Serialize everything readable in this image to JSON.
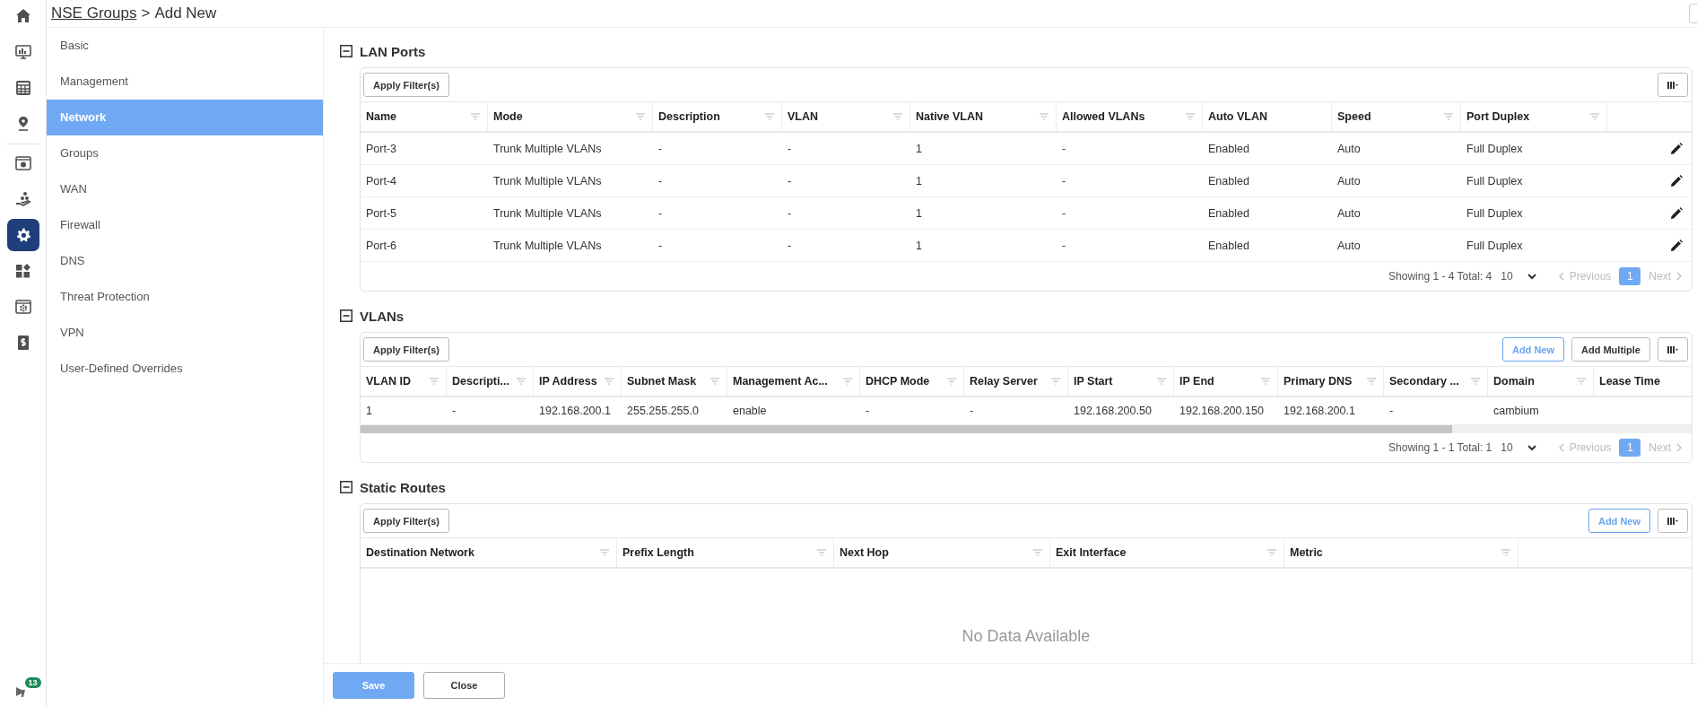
{
  "breadcrumb": {
    "link": "NSE Groups",
    "separator": ">",
    "current": "Add New"
  },
  "rail": {
    "items": [
      {
        "selected": false
      },
      {
        "selected": false
      },
      {
        "selected": false
      },
      {
        "selected": false
      },
      {
        "selected": false
      },
      {
        "selected": false
      },
      {
        "selected": true
      },
      {
        "selected": false
      },
      {
        "selected": false
      },
      {
        "selected": false
      }
    ],
    "notifications": {
      "badge": "13"
    }
  },
  "nav": {
    "items": [
      {
        "label": "Basic",
        "selected": false
      },
      {
        "label": "Management",
        "selected": false
      },
      {
        "label": "Network",
        "selected": true
      },
      {
        "label": "Groups",
        "selected": false
      },
      {
        "label": "WAN",
        "selected": false
      },
      {
        "label": "Firewall",
        "selected": false
      },
      {
        "label": "DNS",
        "selected": false
      },
      {
        "label": "Threat Protection",
        "selected": false
      },
      {
        "label": "VPN",
        "selected": false
      },
      {
        "label": "User-Defined Overrides",
        "selected": false
      }
    ]
  },
  "sections": [
    {
      "title": "LAN Ports",
      "expanded": true,
      "filter_button": "Apply Filter(s)",
      "table": {
        "columns": [
          {
            "label": "Name",
            "filter": true
          },
          {
            "label": "Mode",
            "filter": true
          },
          {
            "label": "Description",
            "filter": true
          },
          {
            "label": "VLAN",
            "filter": true
          },
          {
            "label": "Native VLAN",
            "filter": true
          },
          {
            "label": "Allowed VLANs",
            "filter": true
          },
          {
            "label": "Auto VLAN",
            "filter": false
          },
          {
            "label": "Speed",
            "filter": true
          },
          {
            "label": "Port Duplex",
            "filter": true
          },
          {}
        ],
        "rows": [
          {
            "cells": [
              "Port-3",
              "Trunk Multiple VLANs",
              "-",
              "-",
              "1",
              "-",
              "Enabled",
              "Auto",
              "Full Duplex"
            ],
            "editable": true
          },
          {
            "cells": [
              "Port-4",
              "Trunk Multiple VLANs",
              "-",
              "-",
              "1",
              "-",
              "Enabled",
              "Auto",
              "Full Duplex"
            ],
            "editable": true
          },
          {
            "cells": [
              "Port-5",
              "Trunk Multiple VLANs",
              "-",
              "-",
              "1",
              "-",
              "Enabled",
              "Auto",
              "Full Duplex"
            ],
            "editable": true
          },
          {
            "cells": [
              "Port-6",
              "Trunk Multiple VLANs",
              "-",
              "-",
              "1",
              "-",
              "Enabled",
              "Auto",
              "Full Duplex"
            ],
            "editable": true
          }
        ]
      },
      "pagination": {
        "summary": "Showing 1 - 4 Total: 4",
        "page_size": "10",
        "previous": {
          "label": "Previous",
          "disabled": true
        },
        "pages": [
          {
            "label": "1",
            "selected": true
          }
        ],
        "next": {
          "label": "Next",
          "disabled": true
        }
      }
    },
    {
      "title": "VLANs",
      "expanded": true,
      "filter_button": "Apply Filter(s)",
      "buttons": [
        {
          "label": "Add New",
          "kind": "outline"
        },
        {
          "label": "Add Multiple",
          "kind": "default"
        }
      ],
      "table": {
        "horizontal_scroll": true,
        "columns": [
          {
            "label": "VLAN ID",
            "filter": true
          },
          {
            "label": "Descripti...",
            "filter": true
          },
          {
            "label": "IP Address",
            "filter": true
          },
          {
            "label": "Subnet Mask",
            "filter": true
          },
          {
            "label": "Management Ac...",
            "filter": true
          },
          {
            "label": "DHCP Mode",
            "filter": true
          },
          {
            "label": "Relay Server",
            "filter": true
          },
          {
            "label": "IP Start",
            "filter": true
          },
          {
            "label": "IP End",
            "filter": true
          },
          {
            "label": "Primary DNS",
            "filter": true
          },
          {
            "label": "Secondary ...",
            "filter": true
          },
          {
            "label": "Domain",
            "filter": true
          },
          {
            "label": "Lease Time",
            "filter": false
          }
        ],
        "rows": [
          {
            "cells": [
              "1",
              "-",
              "192.168.200.1",
              "255.255.255.0",
              "enable",
              "-",
              "-",
              "192.168.200.50",
              "192.168.200.150",
              "192.168.200.1",
              "-",
              "cambium"
            ]
          }
        ]
      },
      "pagination": {
        "summary": "Showing 1 - 1 Total: 1",
        "page_size": "10",
        "previous": {
          "label": "Previous",
          "disabled": true
        },
        "pages": [
          {
            "label": "1",
            "selected": true
          }
        ],
        "next": {
          "label": "Next",
          "disabled": true
        }
      }
    },
    {
      "title": "Static Routes",
      "expanded": true,
      "filter_button": "Apply Filter(s)",
      "buttons": [
        {
          "label": "Add New",
          "kind": "outline"
        }
      ],
      "table": {
        "columns": [
          {
            "label": "Destination Network",
            "filter": true
          },
          {
            "label": "Prefix Length",
            "filter": true
          },
          {
            "label": "Next Hop",
            "filter": true
          },
          {
            "label": "Exit Interface",
            "filter": true
          },
          {
            "label": "Metric",
            "filter": true
          },
          {}
        ],
        "empty_text": "No Data Available"
      }
    }
  ],
  "footer": {
    "buttons": [
      {
        "label": "Save",
        "kind": "primary"
      },
      {
        "label": "Close",
        "kind": "secondary"
      }
    ]
  }
}
